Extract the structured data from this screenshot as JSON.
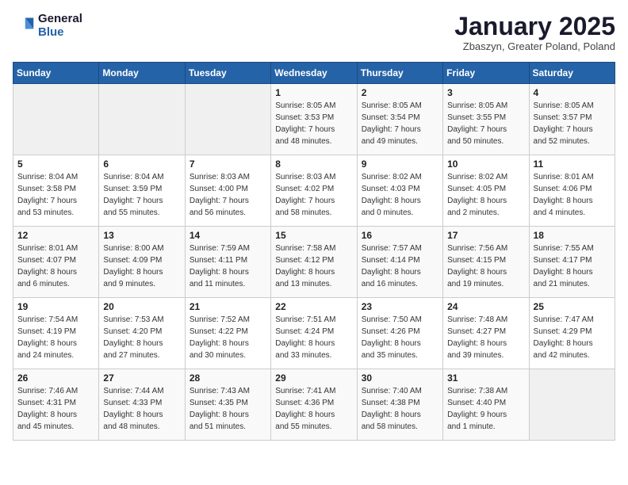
{
  "header": {
    "logo_general": "General",
    "logo_blue": "Blue",
    "month_title": "January 2025",
    "subtitle": "Zbaszyn, Greater Poland, Poland"
  },
  "days_of_week": [
    "Sunday",
    "Monday",
    "Tuesday",
    "Wednesday",
    "Thursday",
    "Friday",
    "Saturday"
  ],
  "weeks": [
    [
      {
        "day": "",
        "text": ""
      },
      {
        "day": "",
        "text": ""
      },
      {
        "day": "",
        "text": ""
      },
      {
        "day": "1",
        "text": "Sunrise: 8:05 AM\nSunset: 3:53 PM\nDaylight: 7 hours\nand 48 minutes."
      },
      {
        "day": "2",
        "text": "Sunrise: 8:05 AM\nSunset: 3:54 PM\nDaylight: 7 hours\nand 49 minutes."
      },
      {
        "day": "3",
        "text": "Sunrise: 8:05 AM\nSunset: 3:55 PM\nDaylight: 7 hours\nand 50 minutes."
      },
      {
        "day": "4",
        "text": "Sunrise: 8:05 AM\nSunset: 3:57 PM\nDaylight: 7 hours\nand 52 minutes."
      }
    ],
    [
      {
        "day": "5",
        "text": "Sunrise: 8:04 AM\nSunset: 3:58 PM\nDaylight: 7 hours\nand 53 minutes."
      },
      {
        "day": "6",
        "text": "Sunrise: 8:04 AM\nSunset: 3:59 PM\nDaylight: 7 hours\nand 55 minutes."
      },
      {
        "day": "7",
        "text": "Sunrise: 8:03 AM\nSunset: 4:00 PM\nDaylight: 7 hours\nand 56 minutes."
      },
      {
        "day": "8",
        "text": "Sunrise: 8:03 AM\nSunset: 4:02 PM\nDaylight: 7 hours\nand 58 minutes."
      },
      {
        "day": "9",
        "text": "Sunrise: 8:02 AM\nSunset: 4:03 PM\nDaylight: 8 hours\nand 0 minutes."
      },
      {
        "day": "10",
        "text": "Sunrise: 8:02 AM\nSunset: 4:05 PM\nDaylight: 8 hours\nand 2 minutes."
      },
      {
        "day": "11",
        "text": "Sunrise: 8:01 AM\nSunset: 4:06 PM\nDaylight: 8 hours\nand 4 minutes."
      }
    ],
    [
      {
        "day": "12",
        "text": "Sunrise: 8:01 AM\nSunset: 4:07 PM\nDaylight: 8 hours\nand 6 minutes."
      },
      {
        "day": "13",
        "text": "Sunrise: 8:00 AM\nSunset: 4:09 PM\nDaylight: 8 hours\nand 9 minutes."
      },
      {
        "day": "14",
        "text": "Sunrise: 7:59 AM\nSunset: 4:11 PM\nDaylight: 8 hours\nand 11 minutes."
      },
      {
        "day": "15",
        "text": "Sunrise: 7:58 AM\nSunset: 4:12 PM\nDaylight: 8 hours\nand 13 minutes."
      },
      {
        "day": "16",
        "text": "Sunrise: 7:57 AM\nSunset: 4:14 PM\nDaylight: 8 hours\nand 16 minutes."
      },
      {
        "day": "17",
        "text": "Sunrise: 7:56 AM\nSunset: 4:15 PM\nDaylight: 8 hours\nand 19 minutes."
      },
      {
        "day": "18",
        "text": "Sunrise: 7:55 AM\nSunset: 4:17 PM\nDaylight: 8 hours\nand 21 minutes."
      }
    ],
    [
      {
        "day": "19",
        "text": "Sunrise: 7:54 AM\nSunset: 4:19 PM\nDaylight: 8 hours\nand 24 minutes."
      },
      {
        "day": "20",
        "text": "Sunrise: 7:53 AM\nSunset: 4:20 PM\nDaylight: 8 hours\nand 27 minutes."
      },
      {
        "day": "21",
        "text": "Sunrise: 7:52 AM\nSunset: 4:22 PM\nDaylight: 8 hours\nand 30 minutes."
      },
      {
        "day": "22",
        "text": "Sunrise: 7:51 AM\nSunset: 4:24 PM\nDaylight: 8 hours\nand 33 minutes."
      },
      {
        "day": "23",
        "text": "Sunrise: 7:50 AM\nSunset: 4:26 PM\nDaylight: 8 hours\nand 35 minutes."
      },
      {
        "day": "24",
        "text": "Sunrise: 7:48 AM\nSunset: 4:27 PM\nDaylight: 8 hours\nand 39 minutes."
      },
      {
        "day": "25",
        "text": "Sunrise: 7:47 AM\nSunset: 4:29 PM\nDaylight: 8 hours\nand 42 minutes."
      }
    ],
    [
      {
        "day": "26",
        "text": "Sunrise: 7:46 AM\nSunset: 4:31 PM\nDaylight: 8 hours\nand 45 minutes."
      },
      {
        "day": "27",
        "text": "Sunrise: 7:44 AM\nSunset: 4:33 PM\nDaylight: 8 hours\nand 48 minutes."
      },
      {
        "day": "28",
        "text": "Sunrise: 7:43 AM\nSunset: 4:35 PM\nDaylight: 8 hours\nand 51 minutes."
      },
      {
        "day": "29",
        "text": "Sunrise: 7:41 AM\nSunset: 4:36 PM\nDaylight: 8 hours\nand 55 minutes."
      },
      {
        "day": "30",
        "text": "Sunrise: 7:40 AM\nSunset: 4:38 PM\nDaylight: 8 hours\nand 58 minutes."
      },
      {
        "day": "31",
        "text": "Sunrise: 7:38 AM\nSunset: 4:40 PM\nDaylight: 9 hours\nand 1 minute."
      },
      {
        "day": "",
        "text": ""
      }
    ]
  ]
}
